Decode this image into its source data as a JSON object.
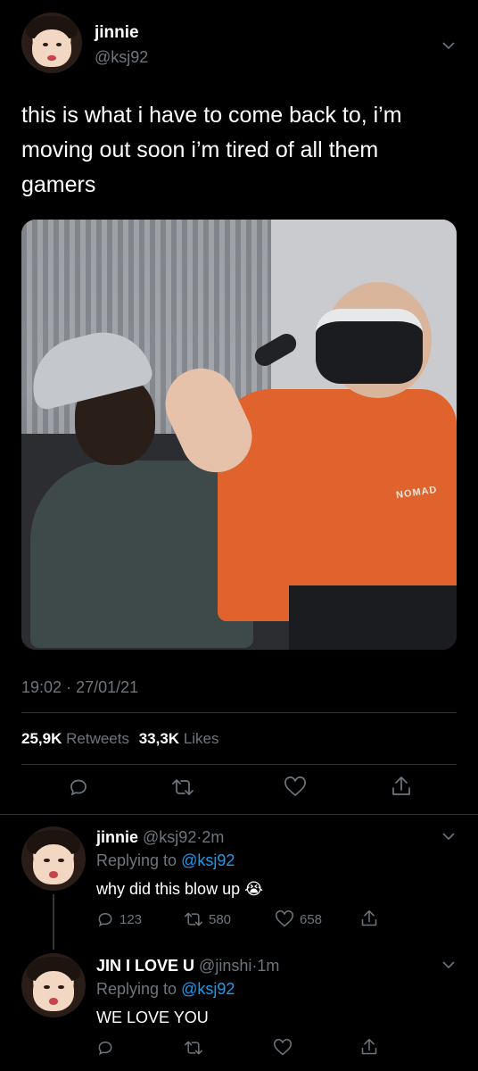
{
  "tweet": {
    "display_name": "jinnie",
    "handle": "@ksj92",
    "text": "this is what i have to come back to, i’m moving out soon i’m tired of all them gamers",
    "time": "19:02",
    "sep": "·",
    "date": "27/01/21",
    "retweets_count": "25,9K",
    "retweets_label": "Retweets",
    "likes_count": "33,3K",
    "likes_label": "Likes",
    "photo_watermark": "NOMAD"
  },
  "replies": [
    {
      "display_name": "jinnie",
      "handle": "@ksj92",
      "sep": "·",
      "age": "2m",
      "replying_label": "Replying to",
      "replying_to": "@ksj92",
      "text": "why did this blow up",
      "emoji": "😭",
      "reply_count": "123",
      "retweet_count": "580",
      "like_count": "658"
    },
    {
      "display_name": "JIN I LOVE U",
      "handle": "@jinshi",
      "sep": "·",
      "age": "1m",
      "replying_label": "Replying to",
      "replying_to": "@ksj92",
      "text": "WE LOVE YOU"
    }
  ],
  "colors": {
    "background": "#000000",
    "text": "#ffffff",
    "secondary": "#6e767d",
    "link": "#1d9bf0",
    "divider": "#2f3336"
  },
  "icons": [
    "chevron-down-icon",
    "reply-icon",
    "retweet-icon",
    "like-icon",
    "share-icon"
  ]
}
